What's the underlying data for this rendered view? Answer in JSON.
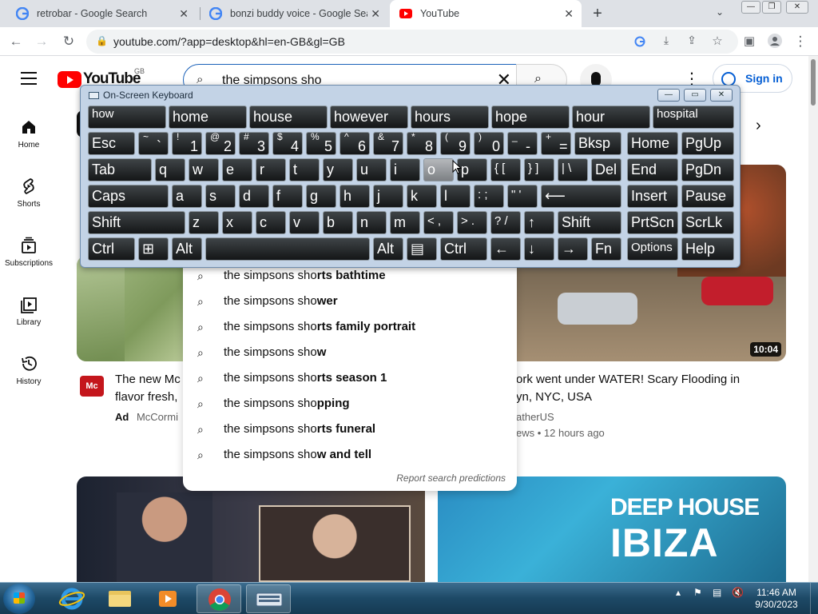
{
  "browser": {
    "tabs": [
      {
        "title": "retrobar - Google Search",
        "icon": "google-icon"
      },
      {
        "title": "bonzi buddy voice - Google Sear",
        "icon": "google-icon"
      },
      {
        "title": "YouTube",
        "icon": "youtube-icon"
      }
    ],
    "url": "youtube.com/?app=desktop&hl=en-GB&gl=GB"
  },
  "youtube": {
    "logo_text": "YouTube",
    "country_code": "GB",
    "search_value": "the simpsons sho",
    "sign_in": "Sign in",
    "guide": [
      {
        "label": "Home",
        "icon": "home-icon"
      },
      {
        "label": "Shorts",
        "icon": "shorts-icon"
      },
      {
        "label": "Subscriptions",
        "icon": "subscriptions-icon"
      },
      {
        "label": "Library",
        "icon": "library-icon"
      },
      {
        "label": "History",
        "icon": "history-icon"
      }
    ],
    "suggestion_typed": "the simpsons sho",
    "suggestions": [
      "rts bathtime",
      "wer",
      "rts family portrait",
      "w",
      "rts season 1",
      "pping",
      "rts funeral",
      "w and tell"
    ],
    "report_link": "Report search predictions",
    "cards": {
      "ad": {
        "title1": "The new Mc",
        "title2": "flavor fresh,",
        "badge": "Ad",
        "channel": "McCormi"
      },
      "flood": {
        "title1": "ork went under WATER! Scary Flooding in",
        "title2": "yn, NYC, USA",
        "channel": "atherUS",
        "meta": "ews • 12 hours ago",
        "duration": "10:04"
      },
      "ibiza": {
        "line1": "DEEP HOUSE",
        "line2": "IBIZA"
      }
    }
  },
  "osk": {
    "title": "On-Screen Keyboard",
    "predictions": [
      "how",
      "home",
      "house",
      "however",
      "hours",
      "hope",
      "hour",
      "hospital"
    ],
    "row1": [
      {
        "label": "Esc"
      },
      {
        "top": "~",
        "bot": "`"
      },
      {
        "top": "!",
        "bot": "1"
      },
      {
        "top": "@",
        "bot": "2"
      },
      {
        "top": "#",
        "bot": "3"
      },
      {
        "top": "$",
        "bot": "4"
      },
      {
        "top": "%",
        "bot": "5"
      },
      {
        "top": "^",
        "bot": "6"
      },
      {
        "top": "&",
        "bot": "7"
      },
      {
        "top": "*",
        "bot": "8"
      },
      {
        "top": "(",
        "bot": "9"
      },
      {
        "top": ")",
        "bot": "0"
      },
      {
        "top": "_",
        "bot": "-"
      },
      {
        "top": "+",
        "bot": "="
      },
      {
        "label": "Bksp"
      },
      {
        "label": "Home"
      },
      {
        "label": "PgUp"
      }
    ],
    "row2": [
      "Tab",
      "q",
      "w",
      "e",
      "r",
      "t",
      "y",
      "u",
      "i",
      "o",
      "p",
      "{ [",
      "} ]",
      "| \\",
      "Del",
      "End",
      "PgDn"
    ],
    "row3": [
      "Caps",
      "a",
      "s",
      "d",
      "f",
      "g",
      "h",
      "j",
      "k",
      "l",
      ": ;",
      "\" '",
      "⟵",
      "Insert",
      "Pause"
    ],
    "row4": [
      "Shift",
      "z",
      "x",
      "c",
      "v",
      "b",
      "n",
      "m",
      "< ,",
      "> .",
      "? /",
      "↑",
      "Shift",
      "PrtScn",
      "ScrLk"
    ],
    "row5": [
      "Ctrl",
      "⊞",
      "Alt",
      "",
      "Alt",
      "▤",
      "Ctrl",
      "←",
      "↓",
      "→",
      "Fn",
      "Options",
      "Help"
    ]
  },
  "taskbar": {
    "time": "11:46 AM",
    "date": "9/30/2023"
  }
}
